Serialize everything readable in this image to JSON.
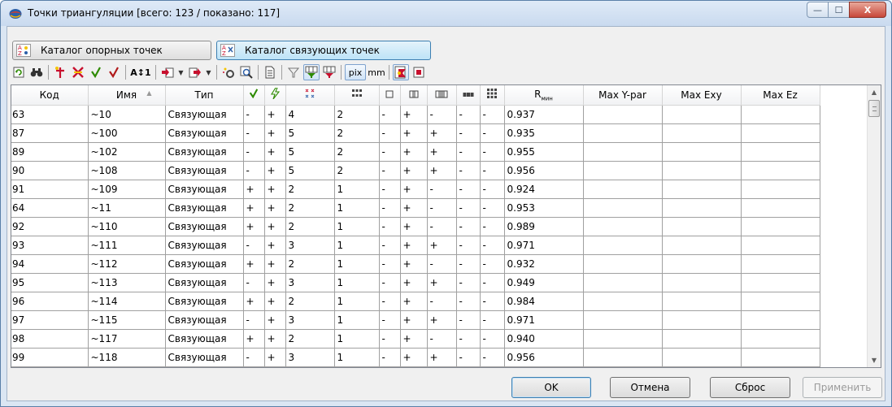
{
  "window": {
    "title": "Точки триангуляции [всего: 123 / показано: 117]",
    "controls": {
      "minimize": "—",
      "maximize": "☐",
      "close": "X"
    }
  },
  "catalog_tabs": [
    {
      "label": "Каталог опорных точек",
      "active": false
    },
    {
      "label": "Каталог связующих точек",
      "active": true
    }
  ],
  "toolbar": {
    "pix_label": "pix",
    "mm_label": "mm",
    "sort_label": "A↕1"
  },
  "table": {
    "columns": [
      "Код",
      "Имя",
      "Тип",
      "",
      "",
      "",
      "",
      "",
      "",
      "",
      "",
      "",
      "R",
      "Max Y-par",
      "Max Exy",
      "Max Ez"
    ],
    "r_subscript": "мин",
    "sort_indicator": "▲",
    "rows": [
      [
        "63",
        "~10",
        "Связующая",
        "-",
        "+",
        "4",
        "2",
        "-",
        "+",
        "-",
        "-",
        "-",
        "0.937",
        "",
        "",
        ""
      ],
      [
        "87",
        "~100",
        "Связующая",
        "-",
        "+",
        "5",
        "2",
        "-",
        "+",
        "+",
        "-",
        "-",
        "0.935",
        "",
        "",
        ""
      ],
      [
        "89",
        "~102",
        "Связующая",
        "-",
        "+",
        "5",
        "2",
        "-",
        "+",
        "+",
        "-",
        "-",
        "0.955",
        "",
        "",
        ""
      ],
      [
        "90",
        "~108",
        "Связующая",
        "-",
        "+",
        "5",
        "2",
        "-",
        "+",
        "+",
        "-",
        "-",
        "0.956",
        "",
        "",
        ""
      ],
      [
        "91",
        "~109",
        "Связующая",
        "+",
        "+",
        "2",
        "1",
        "-",
        "+",
        "-",
        "-",
        "-",
        "0.924",
        "",
        "",
        ""
      ],
      [
        "64",
        "~11",
        "Связующая",
        "+",
        "+",
        "2",
        "1",
        "-",
        "+",
        "-",
        "-",
        "-",
        "0.953",
        "",
        "",
        ""
      ],
      [
        "92",
        "~110",
        "Связующая",
        "+",
        "+",
        "2",
        "1",
        "-",
        "+",
        "-",
        "-",
        "-",
        "0.989",
        "",
        "",
        ""
      ],
      [
        "93",
        "~111",
        "Связующая",
        "-",
        "+",
        "3",
        "1",
        "-",
        "+",
        "+",
        "-",
        "-",
        "0.971",
        "",
        "",
        ""
      ],
      [
        "94",
        "~112",
        "Связующая",
        "+",
        "+",
        "2",
        "1",
        "-",
        "+",
        "-",
        "-",
        "-",
        "0.932",
        "",
        "",
        ""
      ],
      [
        "95",
        "~113",
        "Связующая",
        "-",
        "+",
        "3",
        "1",
        "-",
        "+",
        "+",
        "-",
        "-",
        "0.949",
        "",
        "",
        ""
      ],
      [
        "96",
        "~114",
        "Связующая",
        "+",
        "+",
        "2",
        "1",
        "-",
        "+",
        "-",
        "-",
        "-",
        "0.984",
        "",
        "",
        ""
      ],
      [
        "97",
        "~115",
        "Связующая",
        "-",
        "+",
        "3",
        "1",
        "-",
        "+",
        "+",
        "-",
        "-",
        "0.971",
        "",
        "",
        ""
      ],
      [
        "98",
        "~117",
        "Связующая",
        "+",
        "+",
        "2",
        "1",
        "-",
        "+",
        "-",
        "-",
        "-",
        "0.940",
        "",
        "",
        ""
      ],
      [
        "99",
        "~118",
        "Связующая",
        "-",
        "+",
        "3",
        "1",
        "-",
        "+",
        "+",
        "-",
        "-",
        "0.956",
        "",
        "",
        ""
      ]
    ]
  },
  "buttons": {
    "ok": "OK",
    "cancel": "Отмена",
    "reset": "Сброс",
    "apply": "Применить"
  },
  "colors": {
    "check_green": "#2d8a00",
    "accent_blue": "#3c7fb1",
    "icon_red": "#c8102e",
    "icon_yellow": "#f4c400"
  }
}
